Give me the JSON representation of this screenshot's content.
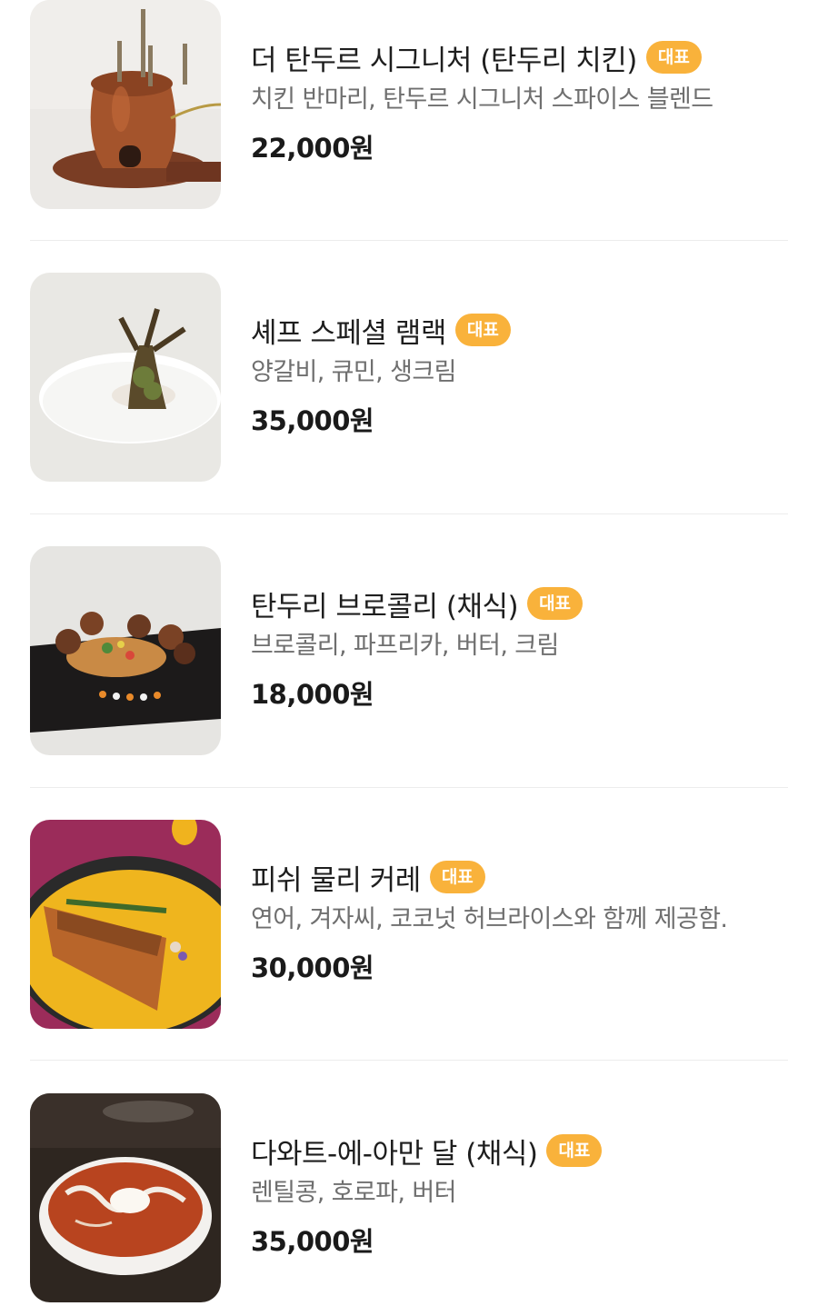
{
  "menu": {
    "items": [
      {
        "title": "더 탄두르 시그니처 (탄두리 치킨)",
        "badge": "대표",
        "description": "치킨 반마리, 탄두르 시그니처 스파이스 블렌드",
        "price": "22,000원",
        "image_icon": "copper-tandoor-photo"
      },
      {
        "title": "셰프 스페셜 램랙",
        "badge": "대표",
        "description": "양갈비, 큐민, 생크림",
        "price": "35,000원",
        "image_icon": "lamb-rack-photo"
      },
      {
        "title": "탄두리 브로콜리 (채식)",
        "badge": "대표",
        "description": "브로콜리, 파프리카, 버터, 크림",
        "price": "18,000원",
        "image_icon": "tandoori-broccoli-photo"
      },
      {
        "title": "피쉬 물리 커레",
        "badge": "대표",
        "description": "연어, 겨자씨, 코코넛 허브라이스와 함께 제공함.",
        "price": "30,000원",
        "image_icon": "fish-curry-photo"
      },
      {
        "title": "다와트-에-아만 달 (채식)",
        "badge": "대표",
        "description": "렌틸콩, 호로파, 버터",
        "price": "35,000원",
        "image_icon": "dal-soup-photo"
      }
    ]
  },
  "colors": {
    "badge_bg": "#f9b23b",
    "badge_text": "#ffffff",
    "title_text": "#1e1e1e",
    "desc_text": "#6f6f6f",
    "divider": "#ececec"
  }
}
